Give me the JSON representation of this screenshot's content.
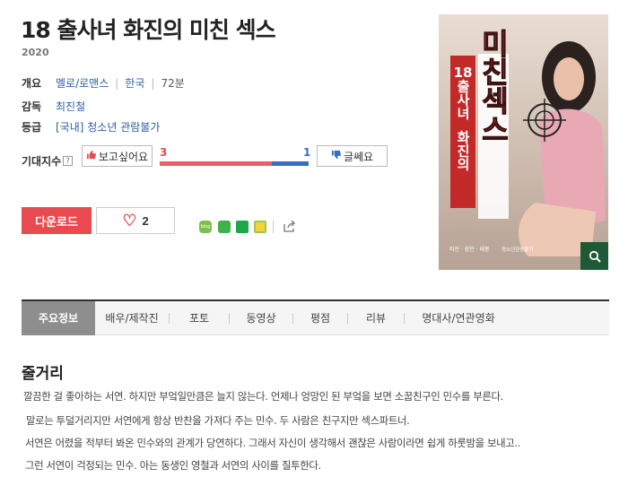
{
  "movie": {
    "title": "18 출사녀 화진의 미친 섹스",
    "year": "2020"
  },
  "info": {
    "overview_label": "개요",
    "genre": "멜로/로맨스",
    "country": "한국",
    "runtime": "72분",
    "director_label": "감독",
    "director": "최진철",
    "rating_label": "등급",
    "rating": "[국내] 청소년 관람불가"
  },
  "expectation": {
    "label": "기대지수",
    "help_icon": "?",
    "want_label": "보고싶어요",
    "not_label": "글쎄요",
    "want_count": "3",
    "not_count": "1",
    "want_ratio": 0.75,
    "colors": {
      "want": "#e84a4f",
      "not": "#3a6fbf"
    }
  },
  "actions": {
    "download_label": "다운로드",
    "like_count": "2",
    "share_icons": [
      "blog-icon",
      "band-icon",
      "naver-icon",
      "kakao-story-icon",
      "external-share-icon"
    ]
  },
  "poster": {
    "vertical_title_1": "18",
    "vertical_title_2": "출사녀",
    "vertical_title_3": "화진의",
    "big_title": "미친섹스",
    "credits_1": "미진 · 장인 · 태봉",
    "credits_2": "청소년관람불가",
    "search_icon": "magnifier-icon"
  },
  "tabs": [
    {
      "label": "주요정보",
      "active": true
    },
    {
      "label": "배우/제작진",
      "active": false
    },
    {
      "label": "포토",
      "active": false
    },
    {
      "label": "동영상",
      "active": false
    },
    {
      "label": "평점",
      "active": false
    },
    {
      "label": "리뷰",
      "active": false
    },
    {
      "label": "명대사/연관영화",
      "active": false
    }
  ],
  "synopsis": {
    "title": "줄거리",
    "lines": [
      "깔끔한 걸 좋아하는 서연. 하지만 부엌일만큼은 늘지 않는다. 언제나 엉망인 된 부엌을 보면 소꿉친구인 민수를 부른다.",
      "말로는 투덜거리지만 서연에게 항상 반찬을 가져다 주는 민수. 두 사람은 친구지만 섹스파트너.",
      "서연은 어렸을 적부터 봐온 민수와의 관계가 당연하다. 그래서 자신이 생각해서 괜찮은 사람이라면 쉽게 하룻밤을 보내고..",
      "그런 서연이 걱정되는 민수. 아는 동생인 영철과 서연의 사이를 질투한다."
    ]
  }
}
